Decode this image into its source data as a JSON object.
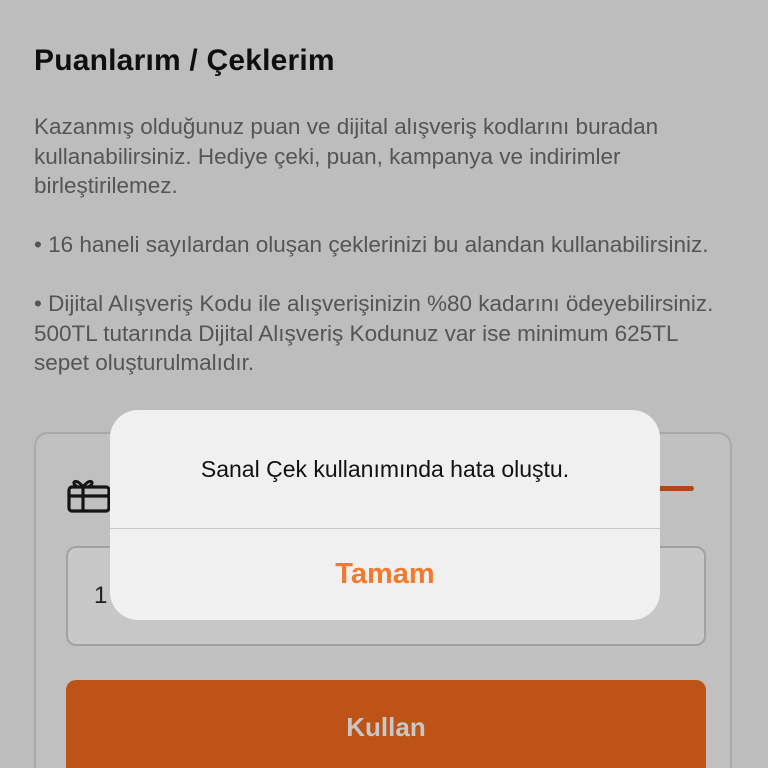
{
  "header": {
    "title": "Puanlarım / Çeklerim"
  },
  "description": {
    "intro": "Kazanmış olduğunuz puan ve dijital alışveriş kodlarını buradan kullanabilirsiniz. Hediye çeki, puan, kampanya ve indirimler birleştirilemez.",
    "bullet_1": "• 16 haneli sayılardan oluşan çeklerinizi bu alandan kullanabilirsiniz.",
    "bullet_2": "• Dijital Alışveriş Kodu ile alışverişinizin %80 kadarını ödeyebilirsiniz. 500TL tutarında Dijital Alışveriş Kodunuz var ise minimum 625TL sepet oluşturulmalıdır."
  },
  "card": {
    "icon": "gift-card-icon",
    "code_input_value": "1",
    "use_button_label": "Kullan"
  },
  "alert": {
    "message": "Sanal Çek kullanımında hata oluştu.",
    "button_label": "Tamam"
  },
  "colors": {
    "accent": "#f26b1d",
    "alert_button": "#f27a2e",
    "background": "#f2f2f2"
  }
}
